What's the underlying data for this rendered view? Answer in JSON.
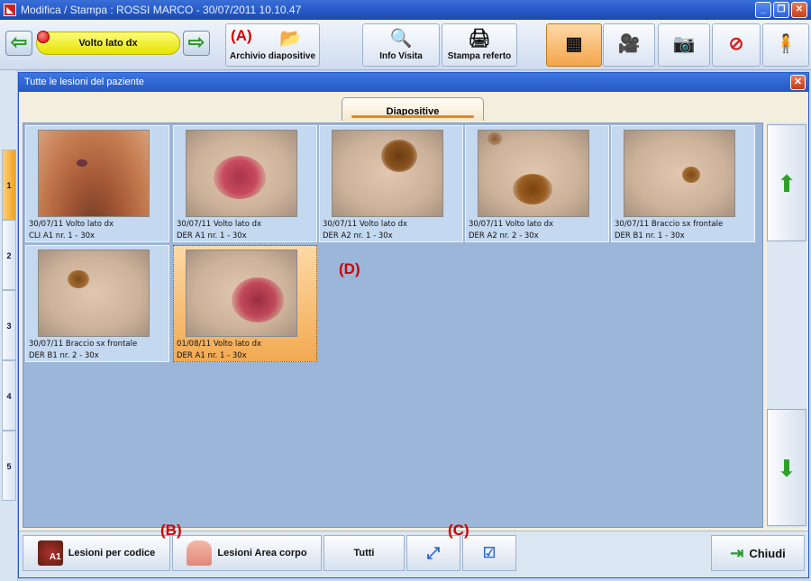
{
  "window": {
    "title": "Modifica / Stampa : ROSSI MARCO - 30/07/2011 10.10.47",
    "app_icon": "app-logo-icon",
    "minimize_icon": "minimize-icon",
    "maximize_icon": "restore-icon",
    "close_icon": "close-icon"
  },
  "toolbar": {
    "location_label": "Volto lato dx",
    "archive_label": "Archivio diapositive",
    "info_label": "Info Visita",
    "print_label": "Stampa referto",
    "markers": {
      "a": "(A)"
    }
  },
  "left_strip": [
    "1",
    "2",
    "3",
    "4",
    "5"
  ],
  "dialog": {
    "title": "Tutte le lesioni del paziente",
    "tab_label": "Diapositive",
    "marker_d": "(D)"
  },
  "thumbnails": [
    {
      "line1": "30/07/11 Volto lato dx",
      "line2": "CLI A1 nr. 1 - 30x",
      "kind": "clinical"
    },
    {
      "line1": "30/07/11 Volto lato dx",
      "line2": "DER A1 nr. 1 - 30x",
      "kind": "red-lesion"
    },
    {
      "line1": "30/07/11 Volto lato dx",
      "line2": "DER A2 nr. 1 - 30x",
      "kind": "brown-lesion"
    },
    {
      "line1": "30/07/11 Volto lato dx",
      "line2": "DER A2 nr. 2 - 30x",
      "kind": "brown-lesion"
    },
    {
      "line1": "30/07/11 Braccio sx frontale",
      "line2": "DER B1 nr. 1 - 30x",
      "kind": "small-brown-lesion"
    },
    {
      "line1": "30/07/11 Braccio sx frontale",
      "line2": "DER B1 nr. 2 - 30x",
      "kind": "small-brown-lesion"
    },
    {
      "line1": "01/08/11 Volto lato dx",
      "line2": "DER A1 nr. 1 - 30x",
      "kind": "red-lesion",
      "selected": true
    }
  ],
  "footer": {
    "by_code_label": "Lesioni per codice",
    "by_area_label": "Lesioni Area corpo",
    "all_label": "Tutti",
    "close_label": "Chiudi",
    "marker_b": "(B)",
    "marker_c": "(C)",
    "code_badge": "A1"
  }
}
